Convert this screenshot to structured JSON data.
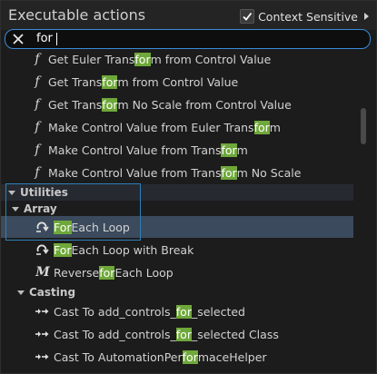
{
  "header": {
    "title": "Executable actions",
    "context_sensitive_label": "Context Sensitive",
    "context_sensitive_checked": true
  },
  "search": {
    "value": "for",
    "placeholder": ""
  },
  "items": [
    {
      "icon": "function-icon",
      "pre": "Get Euler Trans",
      "match": "for",
      "post": "m from Control Value"
    },
    {
      "icon": "function-icon",
      "pre": "Get Trans",
      "match": "for",
      "post": "m from Control Value"
    },
    {
      "icon": "function-icon",
      "pre": "Get Trans",
      "match": "for",
      "post": "m No Scale from Control Value"
    },
    {
      "icon": "function-icon",
      "pre": "Make Control Value from Euler Trans",
      "match": "for",
      "post": "m"
    },
    {
      "icon": "function-icon",
      "pre": "Make Control Value from Trans",
      "match": "for",
      "post": "m"
    },
    {
      "icon": "function-icon",
      "pre": "Make Control Value from Trans",
      "match": "for",
      "post": "m No Scale"
    }
  ],
  "categories": {
    "utilities": "Utilities",
    "array": "Array",
    "casting": "Casting"
  },
  "array_items": [
    {
      "icon": "loop-icon",
      "pre": "",
      "match": "For",
      "post": " Each Loop"
    },
    {
      "icon": "loop-icon",
      "pre": "",
      "match": "For",
      "post": " Each Loop with Break"
    },
    {
      "icon": "macro-icon",
      "pre": "Reverse ",
      "match": "for",
      "post": " Each Loop"
    }
  ],
  "casting_items": [
    {
      "icon": "cast-icon",
      "pre": "Cast To add_controls_",
      "match": "for",
      "post": "_selected"
    },
    {
      "icon": "cast-icon",
      "pre": "Cast To add_controls_",
      "match": "for",
      "post": "_selected Class"
    },
    {
      "icon": "cast-icon",
      "pre": "Cast To AutomationPer",
      "match": "for",
      "post": "maceHelper"
    }
  ],
  "colors": {
    "highlight": "#6fa83a",
    "selection": "#3b4a5c",
    "focus_border": "#3a8bd8"
  }
}
